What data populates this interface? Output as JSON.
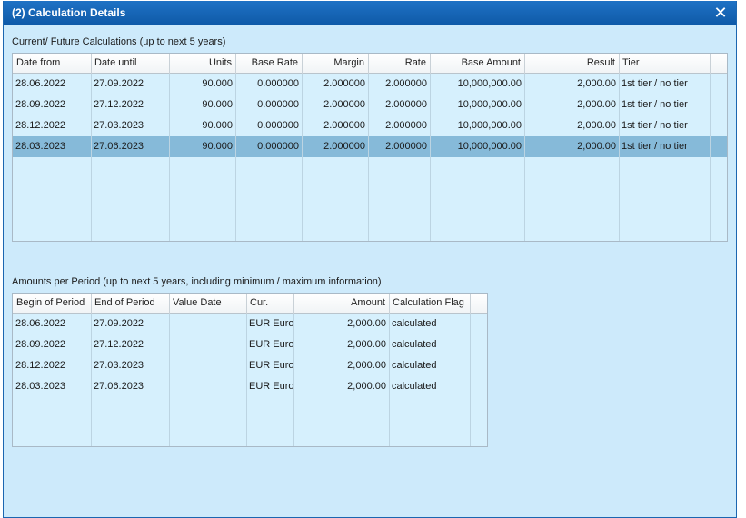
{
  "dialog": {
    "title": "(2) Calculation Details",
    "close_symbol": "✕"
  },
  "calc": {
    "label": "Current/ Future Calculations (up to next 5 years)",
    "columns": [
      "Date from",
      "Date until",
      "Units",
      "Base Rate",
      "Margin",
      "Rate",
      "Base Amount",
      "Result",
      "Tier"
    ],
    "rows": [
      [
        "28.06.2022",
        "27.09.2022",
        "90.000",
        "0.000000",
        "2.000000",
        "2.000000",
        "10,000,000.00",
        "2,000.00",
        "1st tier / no tier"
      ],
      [
        "28.09.2022",
        "27.12.2022",
        "90.000",
        "0.000000",
        "2.000000",
        "2.000000",
        "10,000,000.00",
        "2,000.00",
        "1st tier / no tier"
      ],
      [
        "28.12.2022",
        "27.03.2023",
        "90.000",
        "0.000000",
        "2.000000",
        "2.000000",
        "10,000,000.00",
        "2,000.00",
        "1st tier / no tier"
      ],
      [
        "28.03.2023",
        "27.06.2023",
        "90.000",
        "0.000000",
        "2.000000",
        "2.000000",
        "10,000,000.00",
        "2,000.00",
        "1st tier / no tier"
      ]
    ],
    "selected_row": 3
  },
  "amounts": {
    "label": "Amounts per Period (up to next 5 years, including minimum / maximum information)",
    "columns": [
      "Begin of Period",
      "End of Period",
      "Value Date",
      "Cur.",
      "Amount",
      "Calculation Flag"
    ],
    "rows": [
      [
        "28.06.2022",
        "27.09.2022",
        "",
        "EUR Euro",
        "2,000.00",
        "calculated"
      ],
      [
        "28.09.2022",
        "27.12.2022",
        "",
        "EUR Euro",
        "2,000.00",
        "calculated"
      ],
      [
        "28.12.2022",
        "27.03.2023",
        "",
        "EUR Euro",
        "2,000.00",
        "calculated"
      ],
      [
        "28.03.2023",
        "27.06.2023",
        "",
        "EUR Euro",
        "2,000.00",
        "calculated"
      ]
    ]
  },
  "colors": {
    "selected_row": "#86bad9",
    "title_bar": "#1668ba",
    "dialog_bg": "#cdeafb"
  }
}
